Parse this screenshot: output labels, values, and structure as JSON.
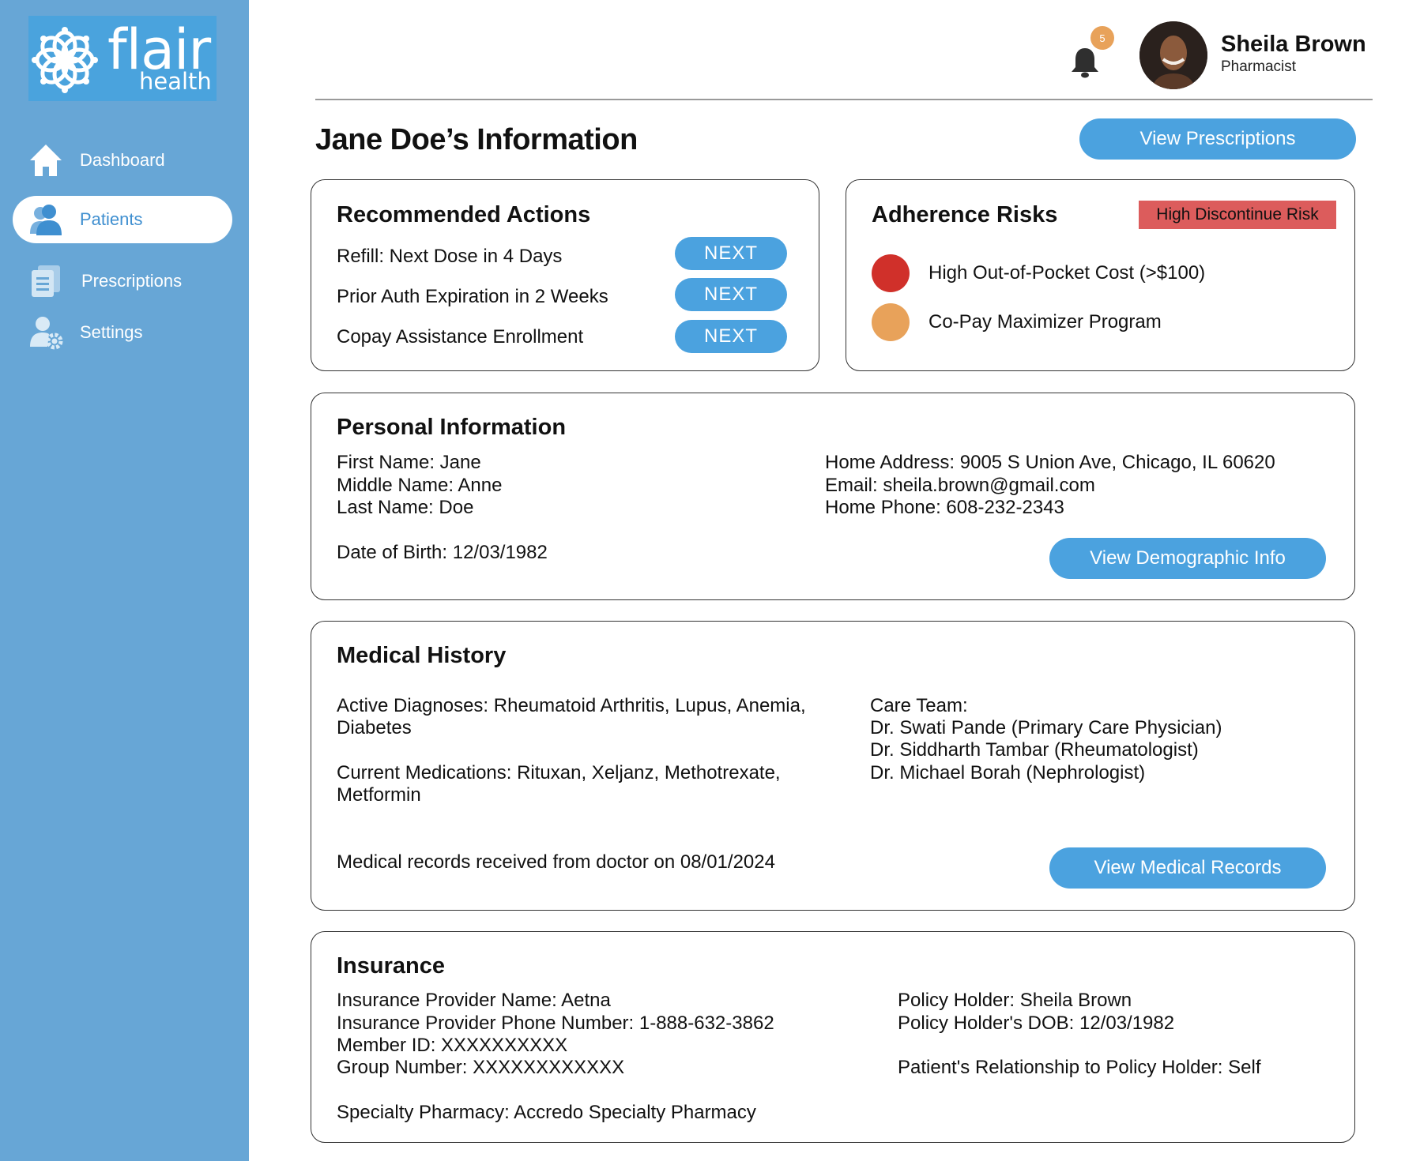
{
  "brand": {
    "word1": "flair",
    "word2": "health"
  },
  "sidebar": {
    "items": [
      {
        "label": "Dashboard",
        "icon": "home-icon"
      },
      {
        "label": "Patients",
        "icon": "user-icon",
        "active": true
      },
      {
        "label": "Prescriptions",
        "icon": "documents-icon"
      },
      {
        "label": "Settings",
        "icon": "user-gear-icon"
      }
    ]
  },
  "header": {
    "notification_count": "5",
    "user_name": "Sheila Brown",
    "user_role": "Pharmacist"
  },
  "page": {
    "title": "Jane Doe’s Information",
    "view_prescriptions_label": "View Prescriptions"
  },
  "recommended_actions": {
    "title": "Recommended Actions",
    "items": [
      {
        "label": "Refill: Next Dose in 4 Days",
        "button": "NEXT"
      },
      {
        "label": "Prior Auth Expiration in 2 Weeks",
        "button": "NEXT"
      },
      {
        "label": "Copay Assistance Enrollment",
        "button": "NEXT"
      }
    ]
  },
  "adherence_risks": {
    "title": "Adherence Risks",
    "tag": "High Discontinue Risk",
    "tag_color": "#dc5c5c",
    "items": [
      {
        "label": "High Out-of-Pocket Cost (>$100)",
        "color": "#d0302a"
      },
      {
        "label": "Co-Pay Maximizer Program",
        "color": "#e8a25a"
      }
    ]
  },
  "personal_info": {
    "title": "Personal Information",
    "first_name": "First Name: Jane",
    "middle_name": "Middle Name: Anne",
    "last_name": "Last Name: Doe",
    "dob": "Date of Birth: 12/03/1982",
    "address": "Home Address: 9005 S Union Ave, Chicago, IL 60620",
    "email": "Email: sheila.brown@gmail.com",
    "phone": "Home Phone: 608-232-2343",
    "button": "View Demographic Info"
  },
  "medical_history": {
    "title": "Medical History",
    "diagnoses_line1": "Active Diagnoses: Rheumatoid Arthritis, Lupus, Anemia,",
    "diagnoses_line2": "Diabetes",
    "medications_line1": "Current Medications: Rituxan, Xeljanz, Methotrexate,",
    "medications_line2": "Metformin",
    "records_note": "Medical records received from doctor on 08/01/2024",
    "care_team_label": "Care Team:",
    "care_team": [
      "Dr. Swati Pande (Primary Care Physician)",
      "Dr. Siddharth Tambar (Rheumatologist)",
      "Dr. Michael Borah (Nephrologist)"
    ],
    "button": "View Medical Records"
  },
  "insurance": {
    "title": "Insurance",
    "provider_name": "Insurance Provider Name: Aetna",
    "provider_phone": "Insurance Provider Phone Number: 1-888-632-3862",
    "member_id": "Member ID: XXXXXXXXXX",
    "group_number": "Group Number: XXXXXXXXXXXX",
    "specialty_pharmacy": "Specialty Pharmacy: Accredo Specialty Pharmacy",
    "policy_holder": "Policy Holder:  Sheila Brown",
    "policy_holder_dob": "Policy Holder's DOB: 12/03/1982",
    "relationship": "Patient's Relationship to Policy Holder: Self"
  },
  "colors": {
    "sidebar": "#67a6d6",
    "accent": "#4ba2df",
    "logo_bg": "#4aa3dd"
  }
}
